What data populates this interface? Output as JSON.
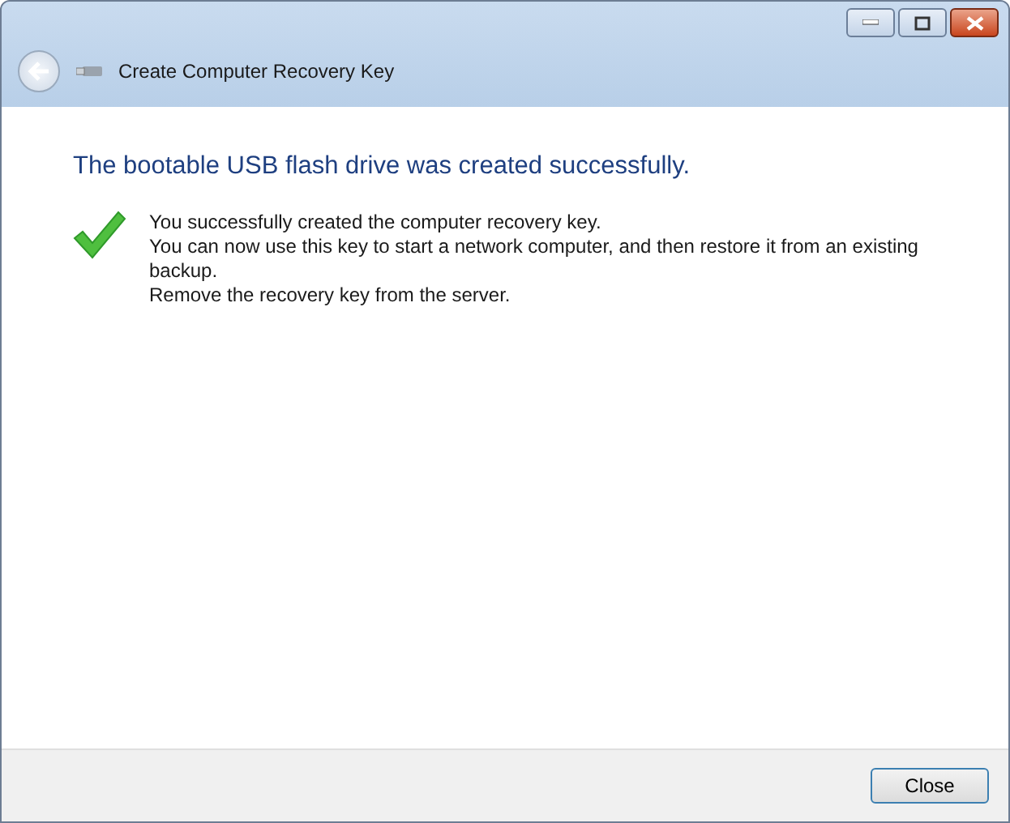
{
  "window": {
    "title": "Create Computer Recovery Key"
  },
  "heading": "The bootable USB flash drive was created successfully.",
  "messages": [
    "You successfully created the computer recovery key.",
    "You can now use this key to start a network computer, and then restore it from an existing backup.",
    "Remove the recovery key from the server."
  ],
  "buttons": [
    "Close"
  ]
}
